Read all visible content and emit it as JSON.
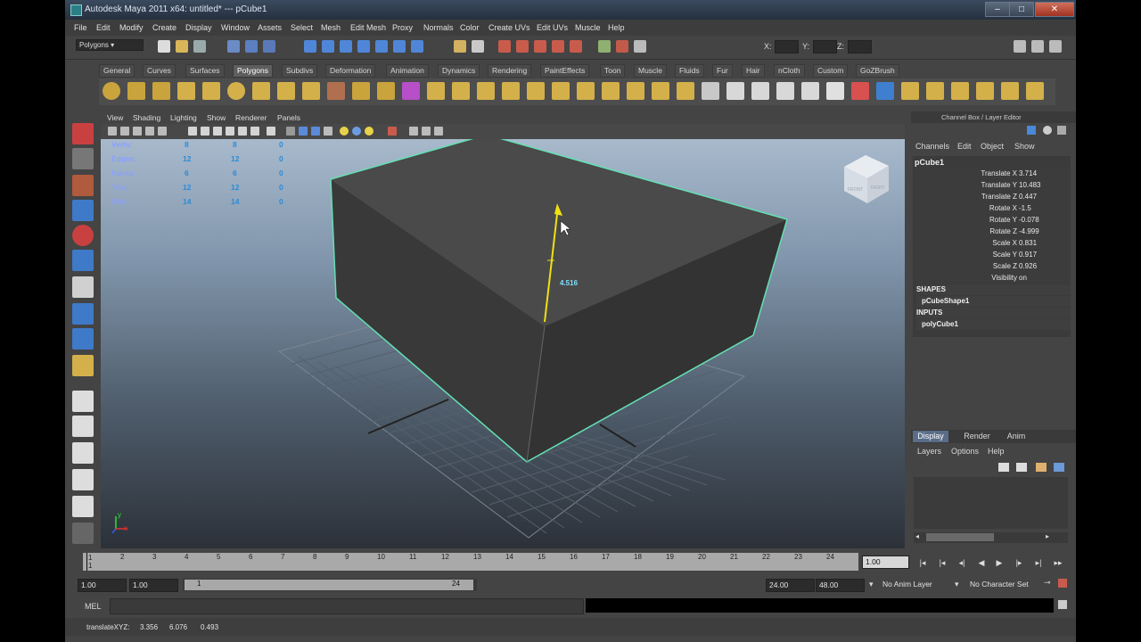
{
  "window": {
    "title": "Autodesk Maya 2011 x64: untitled*   ---   pCube1"
  },
  "menubar": [
    "File",
    "Edit",
    "Modify",
    "Create",
    "Display",
    "Window",
    "Assets",
    "Select",
    "Mesh",
    "Edit Mesh",
    "Proxy",
    "Normals",
    "Color",
    "Create UVs",
    "Edit UVs",
    "Muscle",
    "Help"
  ],
  "status": {
    "mode": "Polygons",
    "x_label": "X:",
    "y_label": "Y:",
    "z_label": "Z:"
  },
  "shelf_tabs": [
    "General",
    "Curves",
    "Surfaces",
    "Polygons",
    "Subdivs",
    "Deformation",
    "Animation",
    "Dynamics",
    "Rendering",
    "PaintEffects",
    "Toon",
    "Muscle",
    "Fluids",
    "Fur",
    "Hair",
    "nCloth",
    "Custom",
    "GoZBrush"
  ],
  "shelf_active": "Polygons",
  "panel_menu": [
    "View",
    "Shading",
    "Lighting",
    "Show",
    "Renderer",
    "Panels"
  ],
  "hud": [
    {
      "label": "Verts:",
      "v1": "8",
      "v2": "8",
      "v3": "0"
    },
    {
      "label": "Edges:",
      "v1": "12",
      "v2": "12",
      "v3": "0"
    },
    {
      "label": "Faces:",
      "v1": "6",
      "v2": "6",
      "v3": "0"
    },
    {
      "label": "Tris:",
      "v1": "12",
      "v2": "12",
      "v3": "0"
    },
    {
      "label": "UVs:",
      "v1": "14",
      "v2": "14",
      "v3": "0"
    }
  ],
  "viewport": {
    "manip_value": "4.516",
    "cube_labels": [
      "FRONT",
      "RIGHT"
    ],
    "axis_x": "x",
    "axis_y": "y"
  },
  "channel_box": {
    "header": "Channel Box / Layer Editor",
    "menu": [
      "Channels",
      "Edit",
      "Object",
      "Show"
    ],
    "object": "pCube1",
    "attrs": [
      {
        "name": "Translate X",
        "value": "3.714"
      },
      {
        "name": "Translate Y",
        "value": "10.483"
      },
      {
        "name": "Translate Z",
        "value": "0.447"
      },
      {
        "name": "Rotate X",
        "value": "-1.5"
      },
      {
        "name": "Rotate Y",
        "value": "-0.078"
      },
      {
        "name": "Rotate Z",
        "value": "-4.999"
      },
      {
        "name": "Scale X",
        "value": "0.831"
      },
      {
        "name": "Scale Y",
        "value": "0.917"
      },
      {
        "name": "Scale Z",
        "value": "0.926"
      },
      {
        "name": "Visibility",
        "value": "on"
      }
    ],
    "shapes_label": "SHAPES",
    "shape": "pCubeShape1",
    "inputs_label": "INPUTS",
    "input": "polyCube1"
  },
  "layer_editor": {
    "tabs": [
      "Display",
      "Render",
      "Anim"
    ],
    "menu": [
      "Layers",
      "Options",
      "Help"
    ]
  },
  "timeline": {
    "ticks": [
      "1",
      "2",
      "3",
      "4",
      "5",
      "6",
      "7",
      "8",
      "9",
      "10",
      "11",
      "12",
      "13",
      "14",
      "15",
      "16",
      "17",
      "18",
      "19",
      "20",
      "21",
      "22",
      "23",
      "24"
    ],
    "current_frame": "1.00",
    "current_marker": "1"
  },
  "range": {
    "start": "1.00",
    "start2": "1.00",
    "slider_start": "1",
    "slider_end": "24",
    "end": "24.00",
    "end2": "48.00",
    "anim_layer": "No Anim Layer",
    "char_set": "No Character Set"
  },
  "command": {
    "label": "MEL"
  },
  "help": {
    "label": "translateXYZ:",
    "x": "3.356",
    "y": "6.076",
    "z": "0.493"
  }
}
